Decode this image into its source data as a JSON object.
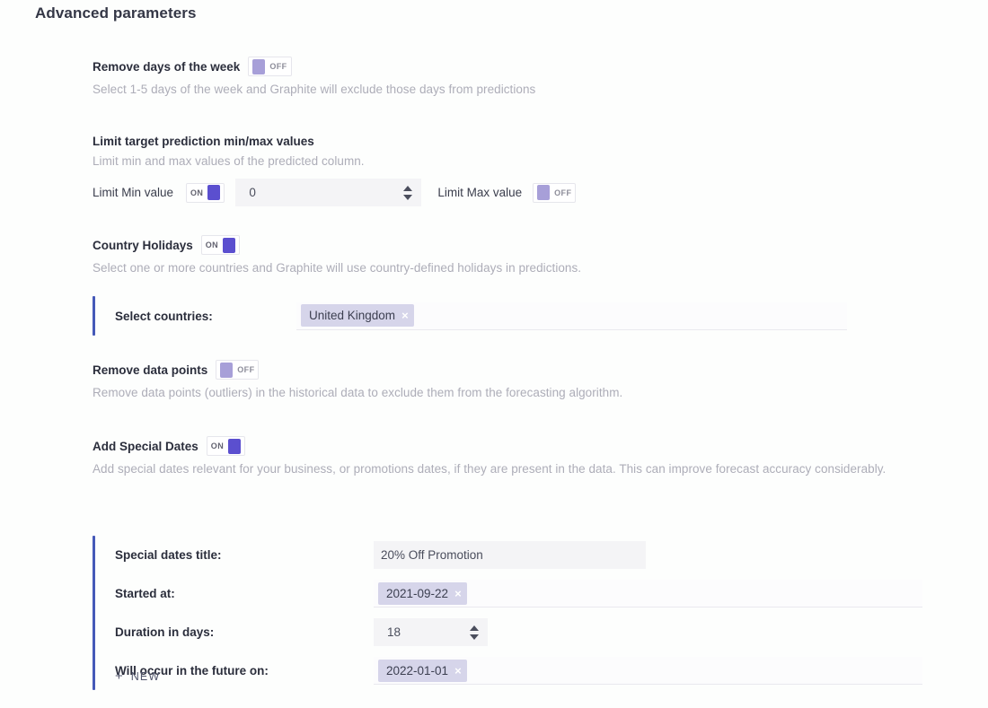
{
  "page": {
    "title": "Advanced parameters"
  },
  "toggle_states": {
    "on": "ON",
    "off": "OFF"
  },
  "sections": {
    "remove_days": {
      "label": "Remove days of the week",
      "toggle": "OFF",
      "description": "Select 1-5 days of the week and Graphite will exclude those days from predictions"
    },
    "limit_values": {
      "label": "Limit target prediction min/max values",
      "description": "Limit min and max values of the predicted column.",
      "min_label": "Limit Min value",
      "min_toggle": "ON",
      "min_value": "0",
      "max_label": "Limit Max value",
      "max_toggle": "OFF"
    },
    "country_holidays": {
      "label": "Country Holidays",
      "toggle": "ON",
      "description": "Select one or more countries and Graphite will use country-defined holidays in predictions.",
      "select_label": "Select countries:",
      "selected": [
        {
          "text": "United Kingdom",
          "remove": "×"
        }
      ]
    },
    "remove_data_points": {
      "label": "Remove data points",
      "toggle": "OFF",
      "description": "Remove data points (outliers) in the historical data to exclude them from the forecasting algorithm."
    },
    "special_dates": {
      "label": "Add Special Dates",
      "toggle": "ON",
      "description": "Add special dates relevant for your business, or promotions dates, if they are present in the data. This can improve forecast accuracy considerably.",
      "rows": {
        "title": {
          "label": "Special dates title:",
          "value": "20% Off Promotion"
        },
        "started": {
          "label": "Started at:",
          "chip": "2021-09-22",
          "remove": "×"
        },
        "duration": {
          "label": "Duration in days:",
          "value": "18"
        },
        "future": {
          "label": "Will occur in the future on:",
          "chip": "2022-01-01",
          "remove": "×"
        }
      },
      "new_button": {
        "icon": "+",
        "label": "NEW"
      }
    }
  },
  "colors": {
    "accent_bar": "#4559b8",
    "toggle_on": "#5b4fcf",
    "toggle_off": "#a79fd8",
    "chip_bg": "#d6d5ea"
  }
}
